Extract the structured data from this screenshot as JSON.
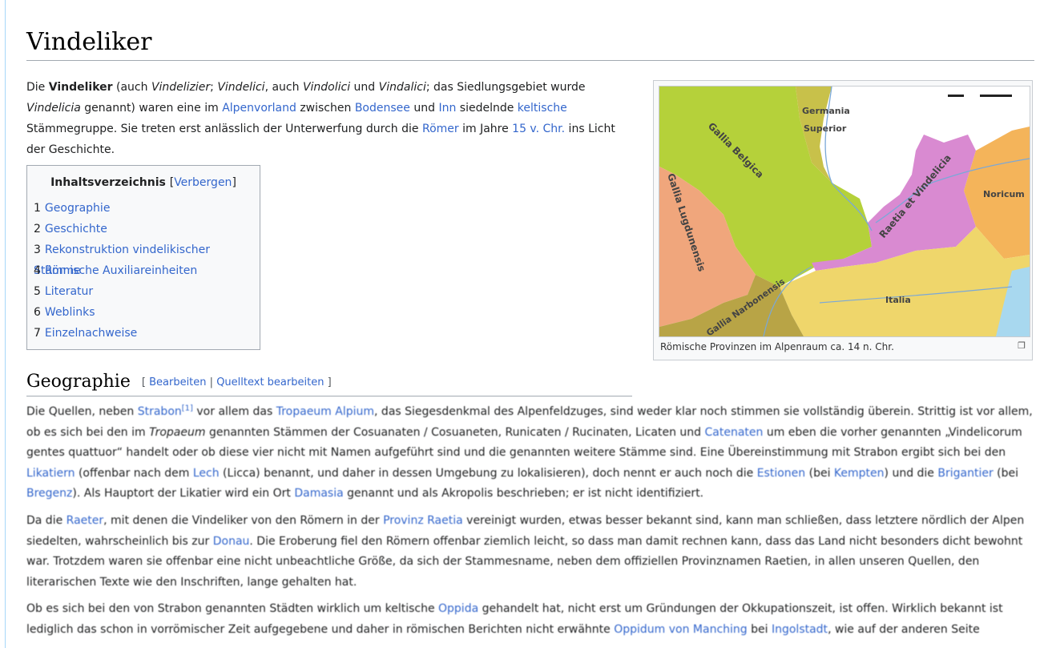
{
  "title": "Vindeliker",
  "intro": {
    "t1": "Die ",
    "bold": "Vindeliker",
    "t2": " (auch ",
    "i1": "Vindelizier",
    "t3": "; ",
    "i2": "Vindelici",
    "t4": ", auch ",
    "i3": "Vindolici",
    "t5": " und ",
    "i4": "Vindalici",
    "t6": "; das Siedlungsgebiet wurde ",
    "i5": "Vindelicia",
    "t7": " genannt) waren eine im ",
    "l1": "Alpenvorland",
    "t8": " zwischen ",
    "l2": "Bodensee",
    "t9": " und ",
    "l3": "Inn",
    "t10": " siedelnde ",
    "l4": "keltische",
    "t11": " Stämmegruppe. Sie treten erst anlässlich der Unterwerfung durch die ",
    "l5": "Römer",
    "t12": " im Jahre ",
    "l6": "15 v. Chr.",
    "t13": " ins Licht der Geschichte."
  },
  "toc": {
    "title": "Inhaltsverzeichnis",
    "toggle_open": "[",
    "toggle": "Verbergen",
    "toggle_close": "]",
    "items": [
      {
        "num": "1",
        "label": "Geographie"
      },
      {
        "num": "2",
        "label": "Geschichte"
      },
      {
        "num": "3",
        "label": "Rekonstruktion vindelikischer Stämme"
      },
      {
        "num": "4",
        "label": "Römische Auxiliareinheiten"
      },
      {
        "num": "5",
        "label": "Literatur"
      },
      {
        "num": "6",
        "label": "Weblinks"
      },
      {
        "num": "7",
        "label": "Einzelnachweise"
      }
    ]
  },
  "figure": {
    "caption": "Römische Provinzen im Alpenraum ca. 14 n. Chr.",
    "labels": {
      "germania": "Germania",
      "superior": "Superior",
      "belgica": "Gallia Belgica",
      "lugdunensis": "Gallia Lugdunensis",
      "raetia": "Raetia et Vindelicia",
      "noricum": "Noricum",
      "italia": "Italia",
      "narbonensis": "Gallia Narbonensis"
    },
    "colors": {
      "belgica": "#b5d13a",
      "lugdunensis": "#f0a67c",
      "raetia": "#d98ad1",
      "noricum": "#f4b45a",
      "italia": "#efd66b",
      "germania": "#c8c14a",
      "narbonensis": "#b8a446",
      "sea": "#a8d8ef"
    }
  },
  "section1": {
    "heading": "Geographie",
    "edit_open": "[ ",
    "edit1": "Bearbeiten",
    "edit_sep": " | ",
    "edit2": "Quelltext bearbeiten",
    "edit_close": " ]",
    "p1": {
      "t1": "Die Quellen, neben ",
      "l1": "Strabon",
      "ref": "[1]",
      "t2": " vor allem das ",
      "l2": "Tropaeum Alpium",
      "t3": ", das Siegesdenkmal des Alpenfeldzuges, sind weder klar noch stimmen sie vollständig überein. Strittig ist vor allem, ob es sich bei den im ",
      "i1": "Tropaeum",
      "t4": " genannten Stämmen der Cosuanaten / Cosuaneten, Runicaten / Rucinaten, Licaten und ",
      "l3": "Catenaten",
      "t5": " um eben die vorher genannten „Vindelicorum gentes quattuor“ handelt oder ob diese vier nicht mit Namen aufgeführt sind und die genannten weitere Stämme sind. Eine Übereinstimmung mit Strabon ergibt sich bei den ",
      "l4": "Likatiern",
      "t6": " (offenbar nach dem ",
      "l5": "Lech",
      "t7": " (Licca) benannt, und daher in dessen Umgebung zu lokalisieren), doch nennt er auch noch die ",
      "l6": "Estionen",
      "t8": " (bei ",
      "l7": "Kempten",
      "t9": ") und die ",
      "l8": "Brigantier",
      "t10": " (bei ",
      "l9": "Bregenz",
      "t11": "). Als Hauptort der Likatier wird ein Ort ",
      "l10": "Damasia",
      "t12": " genannt und als Akropolis beschrieben; er ist nicht identifiziert."
    },
    "p2": {
      "t1": "Da die ",
      "l1": "Raeter",
      "t2": ", mit denen die Vindeliker von den Römern in der ",
      "l2": "Provinz Raetia",
      "t3": " vereinigt wurden, etwas besser bekannt sind, kann man schließen, dass letztere nördlich der Alpen siedelten, wahrscheinlich bis zur ",
      "l3": "Donau",
      "t4": ". Die Eroberung fiel den Römern offenbar ziemlich leicht, so dass man damit rechnen kann, dass das Land nicht besonders dicht bewohnt war. Trotzdem waren sie offenbar eine nicht unbeachtliche Größe, da sich der Stammesname, neben dem offiziellen Provinznamen Raetien, in allen unseren Quellen, den literarischen Texte wie den Inschriften, lange gehalten hat."
    },
    "p3": {
      "t1": "Ob es sich bei den von Strabon genannten Städten wirklich um keltische ",
      "l1": "Oppida",
      "t2": " gehandelt hat, nicht erst um Gründungen der Okkupationszeit, ist offen. Wirklich bekannt ist lediglich das schon in vorrömischer Zeit aufgegebene und daher in römischen Berichten nicht erwähnte ",
      "l2": "Oppidum von Manching",
      "t3": " bei ",
      "l3": "Ingolstadt",
      "t4": ", wie auf der anderen Seite"
    }
  }
}
